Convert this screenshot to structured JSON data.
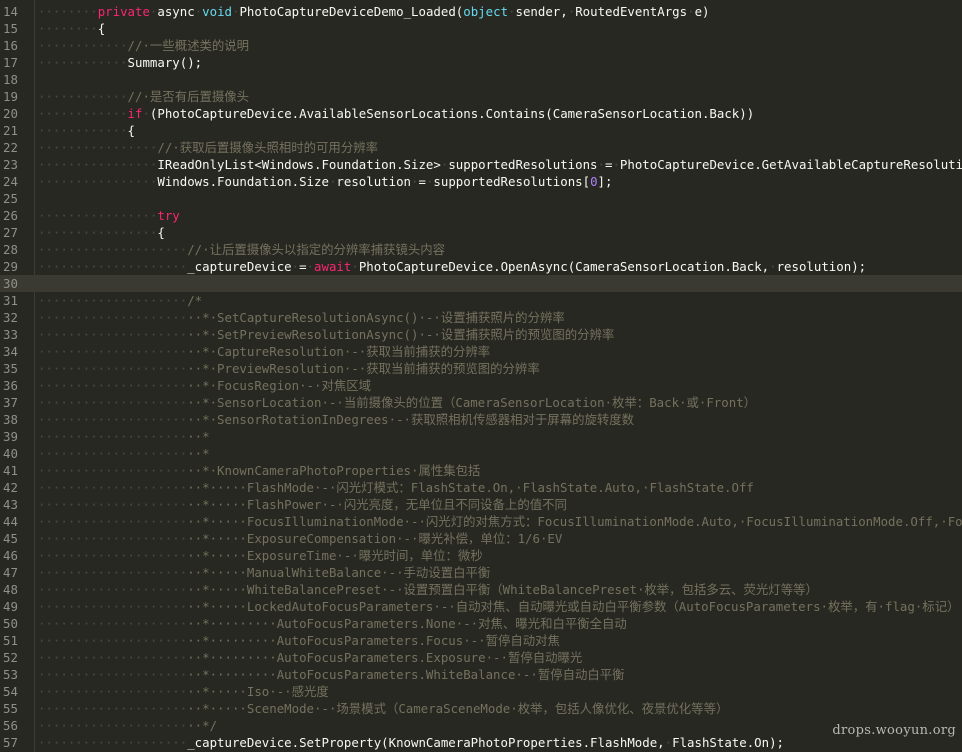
{
  "editor": {
    "lines": [
      {
        "num": "14",
        "indent": 2,
        "tokens": [
          [
            "kw",
            "private"
          ],
          [
            "ws",
            "·"
          ],
          [
            "pl",
            "async"
          ],
          [
            "ws",
            "·"
          ],
          [
            "ty",
            "void"
          ],
          [
            "ws",
            "·"
          ],
          [
            "pl",
            "PhotoCaptureDeviceDemo_Loaded("
          ],
          [
            "ty",
            "object"
          ],
          [
            "ws",
            "·"
          ],
          [
            "pl",
            "sender,"
          ],
          [
            "ws",
            "·"
          ],
          [
            "pl",
            "RoutedEventArgs"
          ],
          [
            "ws",
            "·"
          ],
          [
            "pl",
            "e)"
          ]
        ]
      },
      {
        "num": "15",
        "indent": 2,
        "tokens": [
          [
            "pl",
            "{"
          ]
        ]
      },
      {
        "num": "16",
        "indent": 3,
        "tokens": [
          [
            "cm",
            "//·一些概述类的说明"
          ]
        ]
      },
      {
        "num": "17",
        "indent": 3,
        "tokens": [
          [
            "pl",
            "Summary();"
          ]
        ]
      },
      {
        "num": "18",
        "indent": 0,
        "tokens": []
      },
      {
        "num": "19",
        "indent": 3,
        "tokens": [
          [
            "cm",
            "//·是否有后置摄像头"
          ]
        ]
      },
      {
        "num": "20",
        "indent": 3,
        "tokens": [
          [
            "kw",
            "if"
          ],
          [
            "ws",
            "·"
          ],
          [
            "pl",
            "(PhotoCaptureDevice.AvailableSensorLocations.Contains(CameraSensorLocation.Back))"
          ]
        ]
      },
      {
        "num": "21",
        "indent": 3,
        "tokens": [
          [
            "pl",
            "{"
          ]
        ]
      },
      {
        "num": "22",
        "indent": 4,
        "tokens": [
          [
            "cm",
            "//·获取后置摄像头照相时的可用分辨率"
          ]
        ]
      },
      {
        "num": "23",
        "indent": 4,
        "tokens": [
          [
            "pl",
            "IReadOnlyList<Windows.Foundation.Size>"
          ],
          [
            "ws",
            "·"
          ],
          [
            "pl",
            "supportedResolutions"
          ],
          [
            "ws",
            "·"
          ],
          [
            "pl",
            "="
          ],
          [
            "ws",
            "·"
          ],
          [
            "pl",
            "PhotoCaptureDevice.GetAvailableCaptureResolutions(CameraSensorLocation.Back);"
          ]
        ]
      },
      {
        "num": "24",
        "indent": 4,
        "tokens": [
          [
            "pl",
            "Windows.Foundation.Size"
          ],
          [
            "ws",
            "·"
          ],
          [
            "pl",
            "resolution"
          ],
          [
            "ws",
            "·"
          ],
          [
            "pl",
            "="
          ],
          [
            "ws",
            "·"
          ],
          [
            "pl",
            "supportedResolutions["
          ],
          [
            "num",
            "0"
          ],
          [
            "pl",
            "];"
          ]
        ]
      },
      {
        "num": "25",
        "indent": 0,
        "tokens": []
      },
      {
        "num": "26",
        "indent": 4,
        "tokens": [
          [
            "kw",
            "try"
          ]
        ]
      },
      {
        "num": "27",
        "indent": 4,
        "tokens": [
          [
            "pl",
            "{"
          ]
        ]
      },
      {
        "num": "28",
        "indent": 5,
        "tokens": [
          [
            "cm",
            "//·让后置摄像头以指定的分辨率捕获镜头内容"
          ]
        ]
      },
      {
        "num": "29",
        "indent": 5,
        "tokens": [
          [
            "pl",
            "_captureDevice"
          ],
          [
            "ws",
            "·"
          ],
          [
            "pl",
            "="
          ],
          [
            "ws",
            "·"
          ],
          [
            "kw",
            "await"
          ],
          [
            "ws",
            "·"
          ],
          [
            "pl",
            "PhotoCaptureDevice.OpenAsync(CameraSensorLocation.Back,"
          ],
          [
            "ws",
            "·"
          ],
          [
            "pl",
            "resolution);"
          ]
        ]
      },
      {
        "num": "30",
        "indent": 0,
        "tokens": [],
        "current": true
      },
      {
        "num": "31",
        "indent": 5,
        "tokens": [
          [
            "cm",
            "/*"
          ]
        ]
      },
      {
        "num": "32",
        "indent": 5,
        "tokens": [
          [
            "cm",
            "··*·SetCaptureResolutionAsync()·-·设置捕获照片的分辨率"
          ]
        ]
      },
      {
        "num": "33",
        "indent": 5,
        "tokens": [
          [
            "cm",
            "··*·SetPreviewResolutionAsync()·-·设置捕获照片的预览图的分辨率"
          ]
        ]
      },
      {
        "num": "34",
        "indent": 5,
        "tokens": [
          [
            "cm",
            "··*·CaptureResolution·-·获取当前捕获的分辨率"
          ]
        ]
      },
      {
        "num": "35",
        "indent": 5,
        "tokens": [
          [
            "cm",
            "··*·PreviewResolution·-·获取当前捕获的预览图的分辨率"
          ]
        ]
      },
      {
        "num": "36",
        "indent": 5,
        "tokens": [
          [
            "cm",
            "··*·FocusRegion·-·对焦区域"
          ]
        ]
      },
      {
        "num": "37",
        "indent": 5,
        "tokens": [
          [
            "cm",
            "··*·SensorLocation·-·当前摄像头的位置（CameraSensorLocation·枚举：Back·或·Front）"
          ]
        ]
      },
      {
        "num": "38",
        "indent": 5,
        "tokens": [
          [
            "cm",
            "··*·SensorRotationInDegrees·-·获取照相机传感器相对于屏幕的旋转度数"
          ]
        ]
      },
      {
        "num": "39",
        "indent": 5,
        "tokens": [
          [
            "cm",
            "··*"
          ]
        ]
      },
      {
        "num": "40",
        "indent": 5,
        "tokens": [
          [
            "cm",
            "··*"
          ]
        ]
      },
      {
        "num": "41",
        "indent": 5,
        "tokens": [
          [
            "cm",
            "··*·KnownCameraPhotoProperties·属性集包括"
          ]
        ]
      },
      {
        "num": "42",
        "indent": 5,
        "tokens": [
          [
            "cm",
            "··*·····FlashMode·-·闪光灯模式：FlashState.On,·FlashState.Auto,·FlashState.Off"
          ]
        ]
      },
      {
        "num": "43",
        "indent": 5,
        "tokens": [
          [
            "cm",
            "··*·····FlashPower·-·闪光亮度，无单位且不同设备上的值不同"
          ]
        ]
      },
      {
        "num": "44",
        "indent": 5,
        "tokens": [
          [
            "cm",
            "··*·····FocusIlluminationMode·-·闪光灯的对焦方式：FocusIlluminationMode.Auto,·FocusIlluminationMode.Off,·FocusIlluminationMode.On"
          ]
        ]
      },
      {
        "num": "45",
        "indent": 5,
        "tokens": [
          [
            "cm",
            "··*·····ExposureCompensation·-·曝光补偿，单位：1/6·EV"
          ]
        ]
      },
      {
        "num": "46",
        "indent": 5,
        "tokens": [
          [
            "cm",
            "··*·····ExposureTime·-·曝光时间，单位：微秒"
          ]
        ]
      },
      {
        "num": "47",
        "indent": 5,
        "tokens": [
          [
            "cm",
            "··*·····ManualWhiteBalance·-·手动设置白平衡"
          ]
        ]
      },
      {
        "num": "48",
        "indent": 5,
        "tokens": [
          [
            "cm",
            "··*·····WhiteBalancePreset·-·设置预置白平衡（WhiteBalancePreset·枚举，包括多云、荧光灯等等）"
          ]
        ]
      },
      {
        "num": "49",
        "indent": 5,
        "tokens": [
          [
            "cm",
            "··*·····LockedAutoFocusParameters·-·自动对焦、自动曝光或自动白平衡参数（AutoFocusParameters·枚举，有·flag·标记）"
          ]
        ]
      },
      {
        "num": "50",
        "indent": 5,
        "tokens": [
          [
            "cm",
            "··*·········AutoFocusParameters.None·-·对焦、曝光和白平衡全自动"
          ]
        ]
      },
      {
        "num": "51",
        "indent": 5,
        "tokens": [
          [
            "cm",
            "··*·········AutoFocusParameters.Focus·-·暂停自动对焦"
          ]
        ]
      },
      {
        "num": "52",
        "indent": 5,
        "tokens": [
          [
            "cm",
            "··*·········AutoFocusParameters.Exposure·-·暂停自动曝光"
          ]
        ]
      },
      {
        "num": "53",
        "indent": 5,
        "tokens": [
          [
            "cm",
            "··*·········AutoFocusParameters.WhiteBalance·-·暂停自动白平衡"
          ]
        ]
      },
      {
        "num": "54",
        "indent": 5,
        "tokens": [
          [
            "cm",
            "··*·····Iso·-·感光度"
          ]
        ]
      },
      {
        "num": "55",
        "indent": 5,
        "tokens": [
          [
            "cm",
            "··*·····SceneMode·-·场景模式（CameraSceneMode·枚举，包括人像优化、夜景优化等等）"
          ]
        ]
      },
      {
        "num": "56",
        "indent": 5,
        "tokens": [
          [
            "cm",
            "··*/"
          ]
        ]
      },
      {
        "num": "57",
        "indent": 5,
        "tokens": [
          [
            "pl",
            "_captureDevice.SetProperty(KnownCameraPhotoProperties.FlashMode,"
          ],
          [
            "ws",
            "·"
          ],
          [
            "pl",
            "FlashState.On);"
          ]
        ]
      }
    ]
  },
  "watermark": "drops.wooyun.org",
  "colors": {
    "background": "#272822",
    "keyword": "#f92672",
    "type": "#66d9ef",
    "comment": "#75715e",
    "number": "#ae81ff",
    "plain": "#f8f8f2",
    "line_number": "#8f908a"
  }
}
